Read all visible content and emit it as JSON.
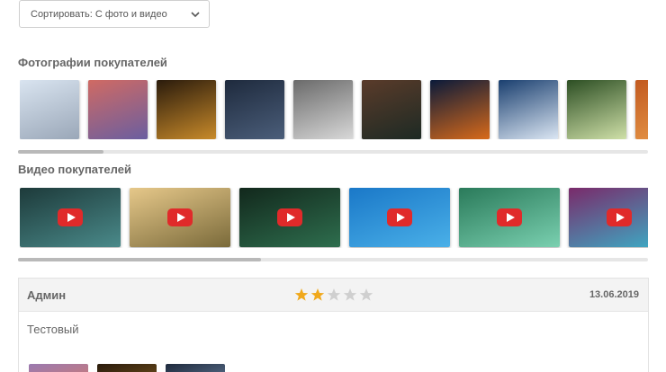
{
  "sort": {
    "label": "Сортировать: С фото и видео"
  },
  "photos": {
    "title": "Фотографии покупателей",
    "items": [
      {
        "icon": "monitor-desk-photo",
        "colors": [
          "#d9e4f0",
          "#9aa7b8"
        ]
      },
      {
        "icon": "pier-sunset-photo",
        "colors": [
          "#d06a63",
          "#6a5ea0"
        ]
      },
      {
        "icon": "golden-leaves-photo",
        "colors": [
          "#2a1b0c",
          "#c88a2a"
        ]
      },
      {
        "icon": "hanging-keys-photo",
        "colors": [
          "#1e2a3d",
          "#4b5e7a"
        ]
      },
      {
        "icon": "koala-photo",
        "colors": [
          "#6a6a6a",
          "#d8d8d8"
        ]
      },
      {
        "icon": "coast-rocks-photo",
        "colors": [
          "#5a3b2a",
          "#1d2a24"
        ]
      },
      {
        "icon": "jellyfish-photo",
        "colors": [
          "#0a1a3a",
          "#d86a1a"
        ]
      },
      {
        "icon": "penguins-photo",
        "colors": [
          "#1a3f6f",
          "#dbe6f3"
        ]
      },
      {
        "icon": "hydrangea-photo",
        "colors": [
          "#2c4e23",
          "#cfe0a8"
        ]
      },
      {
        "icon": "desert-photo",
        "colors": [
          "#c25a20",
          "#e89a4a"
        ]
      }
    ]
  },
  "videos": {
    "title": "Видео покупателей",
    "items": [
      {
        "icon": "forest-lake-video",
        "colors": [
          "#1d3a3a",
          "#4a8a8a"
        ]
      },
      {
        "icon": "meditation-monk-video",
        "colors": [
          "#e6c88a",
          "#7a6a3a"
        ]
      },
      {
        "icon": "fantasy-forest-video",
        "colors": [
          "#12281c",
          "#2e6e4e"
        ]
      },
      {
        "icon": "dolphins-video",
        "colors": [
          "#1a78c8",
          "#4ab0e8"
        ]
      },
      {
        "icon": "green-river-video",
        "colors": [
          "#2a7a5a",
          "#7ad0b0"
        ]
      },
      {
        "icon": "waterfall-video",
        "colors": [
          "#7a2a6a",
          "#3ab0c8"
        ]
      }
    ]
  },
  "review": {
    "author": "Админ",
    "rating": 2,
    "max_rating": 5,
    "date": "13.06.2019",
    "text": "Тестовый",
    "star_color": "#f0a81b",
    "star_empty_color": "#cfcfcf",
    "photos": [
      {
        "icon": "pier-sunset-photo",
        "colors": [
          "#9a7ab0",
          "#c87a7a"
        ]
      },
      {
        "icon": "golden-leaves-photo",
        "colors": [
          "#2a1b0c",
          "#6a4a1a"
        ]
      },
      {
        "icon": "hanging-keys-photo",
        "colors": [
          "#1e2a3d",
          "#5a6e8a"
        ]
      }
    ]
  }
}
